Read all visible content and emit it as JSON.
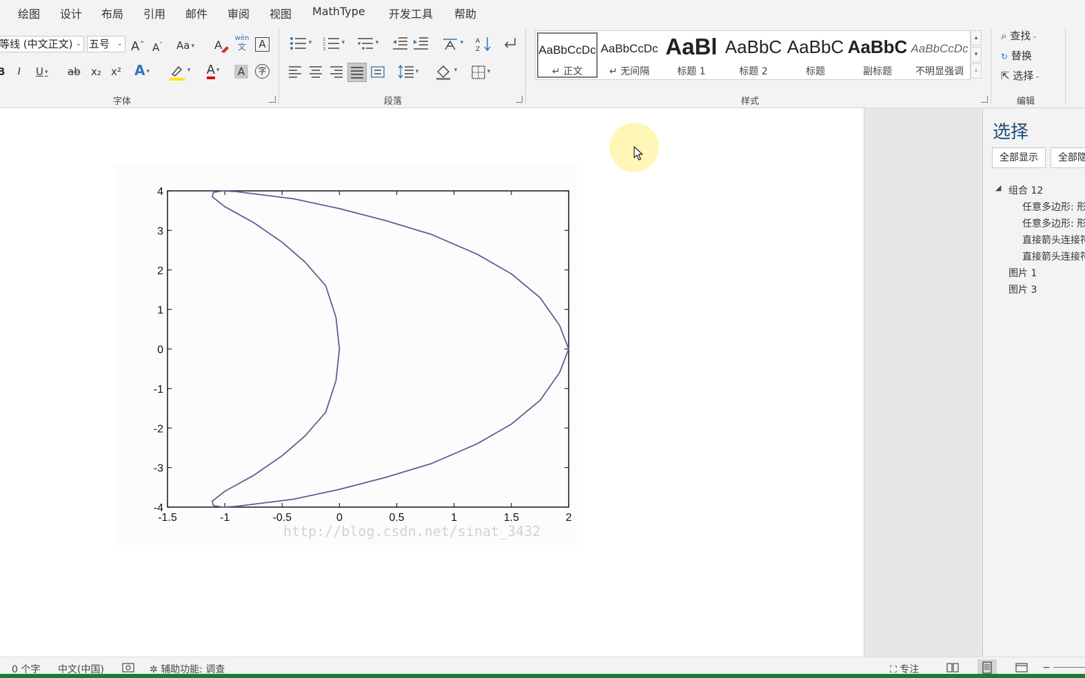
{
  "menu": [
    "绘图",
    "设计",
    "布局",
    "引用",
    "邮件",
    "审阅",
    "视图",
    "MathType",
    "开发工具",
    "帮助"
  ],
  "font": {
    "name": "等线 (中文正文)",
    "size": "五号",
    "group_label": "字体",
    "grow_label": "A",
    "shrink_label": "A",
    "case_label": "Aa",
    "pinyin_top": "wén",
    "pinyin_bottom": "文",
    "border_char": "A",
    "bold": "B",
    "italic": "I",
    "underline": "U",
    "strike": "ab",
    "subscript": "x₂",
    "superscript": "x²",
    "effects": "A",
    "color": "A",
    "shading": "A",
    "enclose": "字"
  },
  "paragraph": {
    "group_label": "段落"
  },
  "styles": {
    "group_label": "样式",
    "items": [
      {
        "sample": "AaBbCcDc",
        "name": "↵ 正文",
        "active": true
      },
      {
        "sample": "AaBbCcDc",
        "name": "↵ 无间隔"
      },
      {
        "sample": "AaBl",
        "name": "标题 1"
      },
      {
        "sample": "AaBbC",
        "name": "标题 2"
      },
      {
        "sample": "AaBbC",
        "name": "标题"
      },
      {
        "sample": "AaBbC",
        "name": "副标题"
      },
      {
        "sample": "AaBbCcDc",
        "name": "不明显强调"
      }
    ]
  },
  "editing": {
    "find": "查找",
    "replace": "替换",
    "select": "选择",
    "group_label": "编辑"
  },
  "figure": {
    "watermark": "http://blog.csdn.net/sinat_3432"
  },
  "chart_data": {
    "type": "line",
    "title": "",
    "xlabel": "",
    "ylabel": "",
    "xlim": [
      -1.5,
      2
    ],
    "ylim": [
      -4,
      4
    ],
    "xticks": [
      "-1.5",
      "-1",
      "-0.5",
      "0",
      "0.5",
      "1",
      "1.5",
      "2"
    ],
    "yticks": [
      "4",
      "3",
      "2",
      "1",
      "0",
      "-1",
      "-2",
      "-3",
      "-4"
    ],
    "grid": false,
    "series": [
      {
        "color": "#5a5e92",
        "x": [
          -1.02,
          -1.1,
          -1.11,
          -1.0,
          -0.75,
          -0.5,
          -0.3,
          -0.12,
          -0.03,
          0.0,
          -0.03,
          -0.12,
          -0.3,
          -0.5,
          -0.75,
          -1.0,
          -1.11,
          -1.1,
          -1.02,
          -0.9,
          -0.4,
          0.0,
          0.4,
          0.8,
          1.2,
          1.5,
          1.75,
          1.92,
          2.0,
          1.92,
          1.75,
          1.5,
          1.2,
          0.8,
          0.4,
          0.0,
          -0.4,
          -0.9,
          -1.02
        ],
        "y": [
          4.0,
          3.96,
          3.85,
          3.6,
          3.2,
          2.7,
          2.2,
          1.6,
          0.8,
          0.0,
          -0.8,
          -1.6,
          -2.2,
          -2.7,
          -3.2,
          -3.6,
          -3.85,
          -3.96,
          -4.0,
          -3.98,
          -3.8,
          -3.55,
          -3.25,
          -2.9,
          -2.4,
          -1.9,
          -1.3,
          -0.6,
          0.0,
          0.6,
          1.3,
          1.9,
          2.4,
          2.9,
          3.25,
          3.55,
          3.8,
          3.98,
          4.0
        ]
      }
    ]
  },
  "selection_pane": {
    "title": "选择",
    "show_all": "全部显示",
    "hide_all": "全部隐藏",
    "tree": [
      {
        "label": "组合 12",
        "level": 0,
        "expander": "◢"
      },
      {
        "label": "任意多边形: 形状",
        "level": 1
      },
      {
        "label": "任意多边形: 形状",
        "level": 1
      },
      {
        "label": "直接箭头连接符",
        "level": 1
      },
      {
        "label": "直接箭头连接符",
        "level": 1
      },
      {
        "label": "图片 1",
        "level": 0
      },
      {
        "label": "图片 3",
        "level": 0
      }
    ]
  },
  "status": {
    "word_count": "0 个字",
    "language": "中文(中国)",
    "accessibility": "辅助功能: 调查",
    "focus": "专注"
  }
}
